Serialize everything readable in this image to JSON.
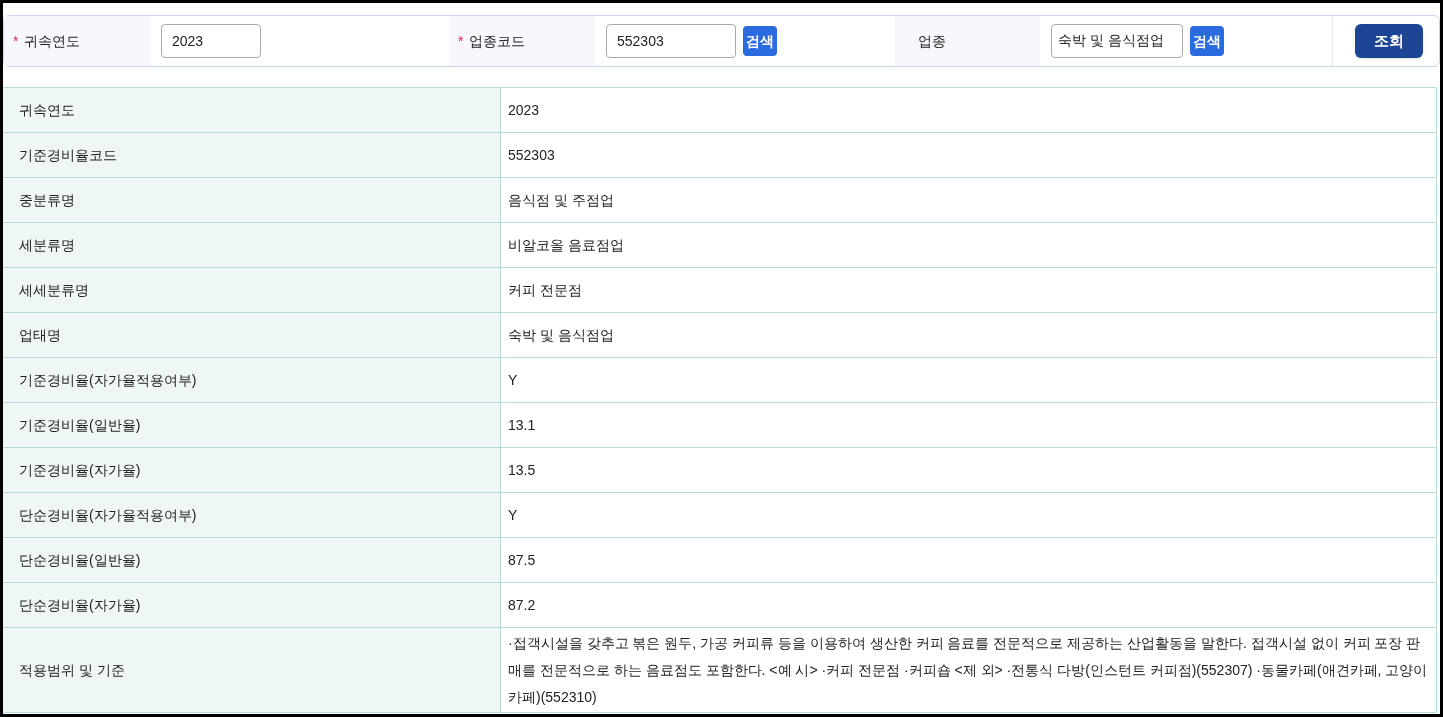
{
  "search": {
    "fields": [
      {
        "required_mark": "*",
        "label": "귀속연도",
        "value": "2023"
      },
      {
        "required_mark": "*",
        "label": "업종코드",
        "value": "552303",
        "search_button": "검색"
      },
      {
        "label": "업종",
        "value": "숙박 및 음식점업",
        "search_button": "검색"
      }
    ],
    "submit": "조회"
  },
  "details": [
    {
      "label": "귀속연도",
      "value": "2023"
    },
    {
      "label": "기준경비율코드",
      "value": "552303"
    },
    {
      "label": "중분류명",
      "value": "음식점 및 주점업"
    },
    {
      "label": "세분류명",
      "value": "비알코올 음료점업"
    },
    {
      "label": "세세분류명",
      "value": "커피 전문점"
    },
    {
      "label": "업태명",
      "value": "숙박 및 음식점업"
    },
    {
      "label": "기준경비율(자가율적용여부)",
      "value": "Y"
    },
    {
      "label": "기준경비율(일반율)",
      "value": "13.1"
    },
    {
      "label": "기준경비율(자가율)",
      "value": "13.5"
    },
    {
      "label": "단순경비율(자가율적용여부)",
      "value": "Y"
    },
    {
      "label": "단순경비율(일반율)",
      "value": "87.5"
    },
    {
      "label": "단순경비율(자가율)",
      "value": "87.2"
    },
    {
      "label": "적용범위 및 기준",
      "value": "·접객시설을 갖추고 볶은 원두, 가공 커피류 등을 이용하여 생산한 커피 음료를 전문적으로 제공하는 산업활동을 말한다. 접객시설 없이 커피 포장 판매를 전문적으로 하는 음료점도 포함한다. <예 시> ·커피 전문점 ·커피숍 <제 외> ·전통식 다방(인스턴트 커피점)(552307) ·동물카페(애견카페, 고양이카페)(552310)"
    }
  ]
}
